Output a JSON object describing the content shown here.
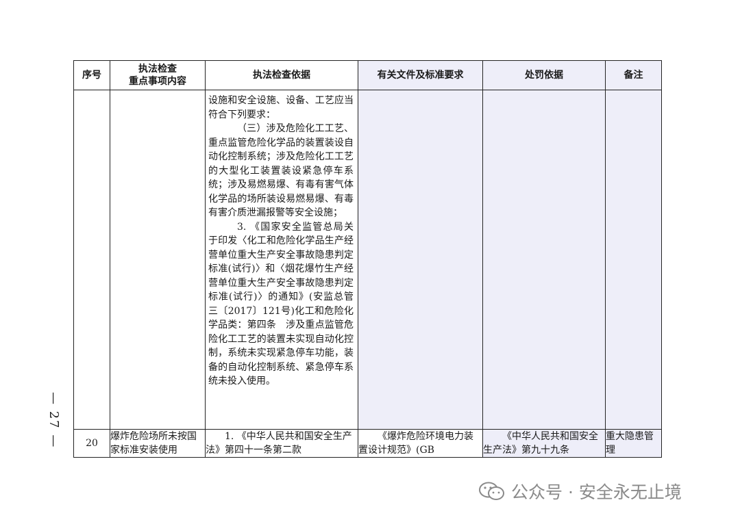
{
  "headers": [
    "序号",
    "执法检查\n重点事项内容",
    "执法检查依据",
    "有关文件及标准要求",
    "处罚依据",
    "备注"
  ],
  "row_cont": {
    "lines": [
      "设施和安全设施、设备、工艺应当符合下列要求：",
      "（三）涉及危险化工工艺、重点监管危险化学品的装置装设自动化控制系统；涉及危险化工工艺的大型化工装置装设紧急停车系统；涉及易燃易爆、有毒有害气体化学品的场所装设易燃易爆、有毒有害介质泄漏报警等安全设施；",
      "3. 《国家安全监管总局关于印发〈化工和危险化学品生产经营单位重大生产安全事故隐患判定标准(试行)〉和〈烟花爆竹生产经营单位重大生产安全事故隐患判定标准(试行)〉的通知》(安监总管三〔2017〕121号)化工和危险化学品类：第四条　涉及重点监管危险化工工艺的装置未实现自动化控制，系统未实现紧急停车功能，装备的自动化控制系统、紧急停车系统未投入使用。"
    ]
  },
  "row20": {
    "no": "20",
    "item": "爆炸危险场所未按国家标准安装使用",
    "basis": "1. 《中华人民共和国安全生产法》第四十一条第二款",
    "standard": "《爆炸危险环境电力装置设计规范》(GB",
    "penalty": "《中华人民共和国安全生产法》第九十九条",
    "remark": "重大隐患管理"
  },
  "page_number": "— 27 —",
  "watermark": "公众号 · 安全永无止境"
}
